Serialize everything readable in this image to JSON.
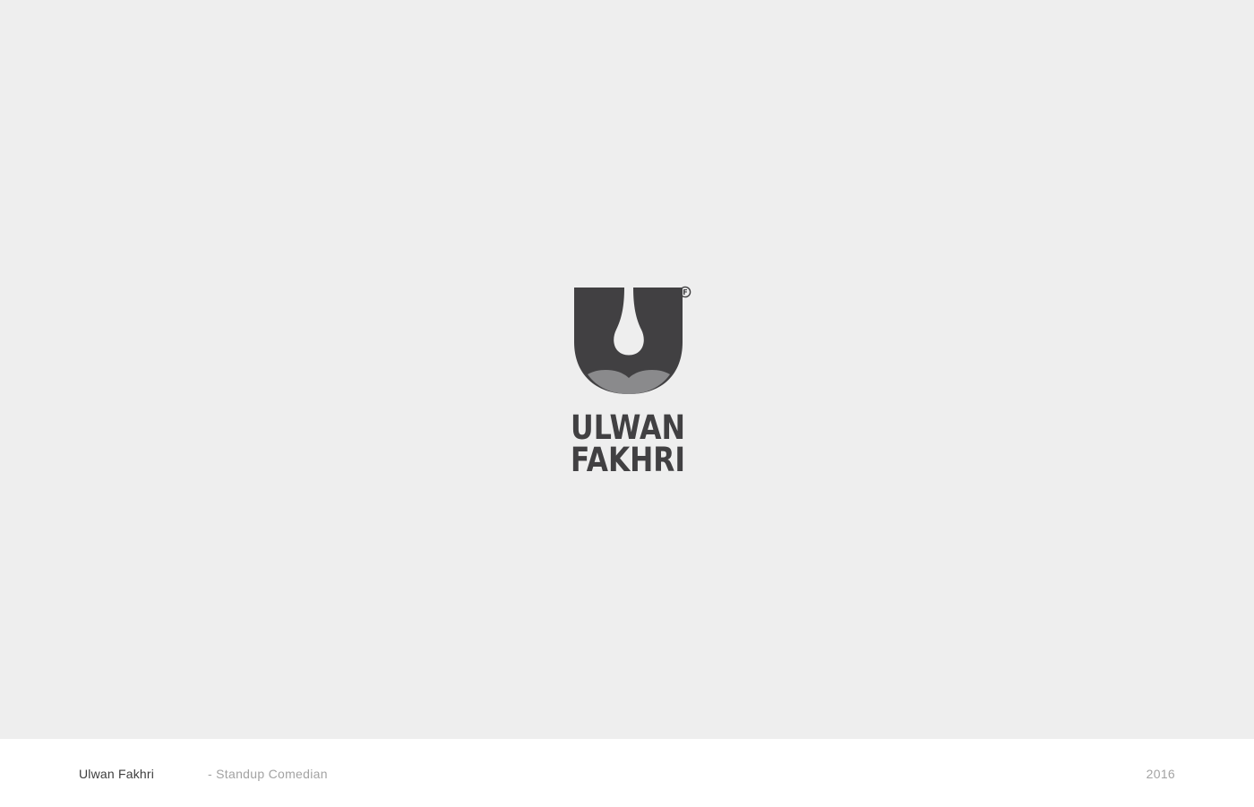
{
  "logo": {
    "line1": "ULWAN",
    "line2": "FAKHRI",
    "mark_symbol": "F",
    "emblem_icon": "u-shield-drop-icon",
    "primary_color": "#414042",
    "secondary_color": "#8a8a8c"
  },
  "footer": {
    "name": "Ulwan Fakhri",
    "role": "- Standup Comedian",
    "year": "2016"
  },
  "colors": {
    "stage_background": "#eeeeee",
    "footer_background": "#ffffff",
    "muted_text": "#a3a3a3",
    "dark_text": "#3d3d3d"
  }
}
